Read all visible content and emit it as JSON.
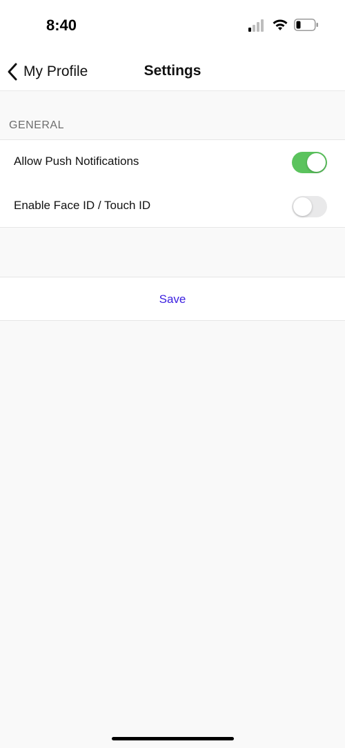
{
  "status_bar": {
    "time": "8:40",
    "icons": [
      "signal-icon",
      "wifi-icon",
      "battery-icon"
    ]
  },
  "nav": {
    "back_label": "My Profile",
    "title": "Settings"
  },
  "general": {
    "header": "GENERAL",
    "rows": [
      {
        "label": "Allow Push Notifications",
        "enabled": true
      },
      {
        "label": "Enable Face ID / Touch ID",
        "enabled": false
      }
    ]
  },
  "save": {
    "label": "Save"
  },
  "colors": {
    "toggle_on": "#5bc35d",
    "toggle_off": "#e9e9ea",
    "accent": "#3a1ee0",
    "background": "#f9f9f9"
  }
}
